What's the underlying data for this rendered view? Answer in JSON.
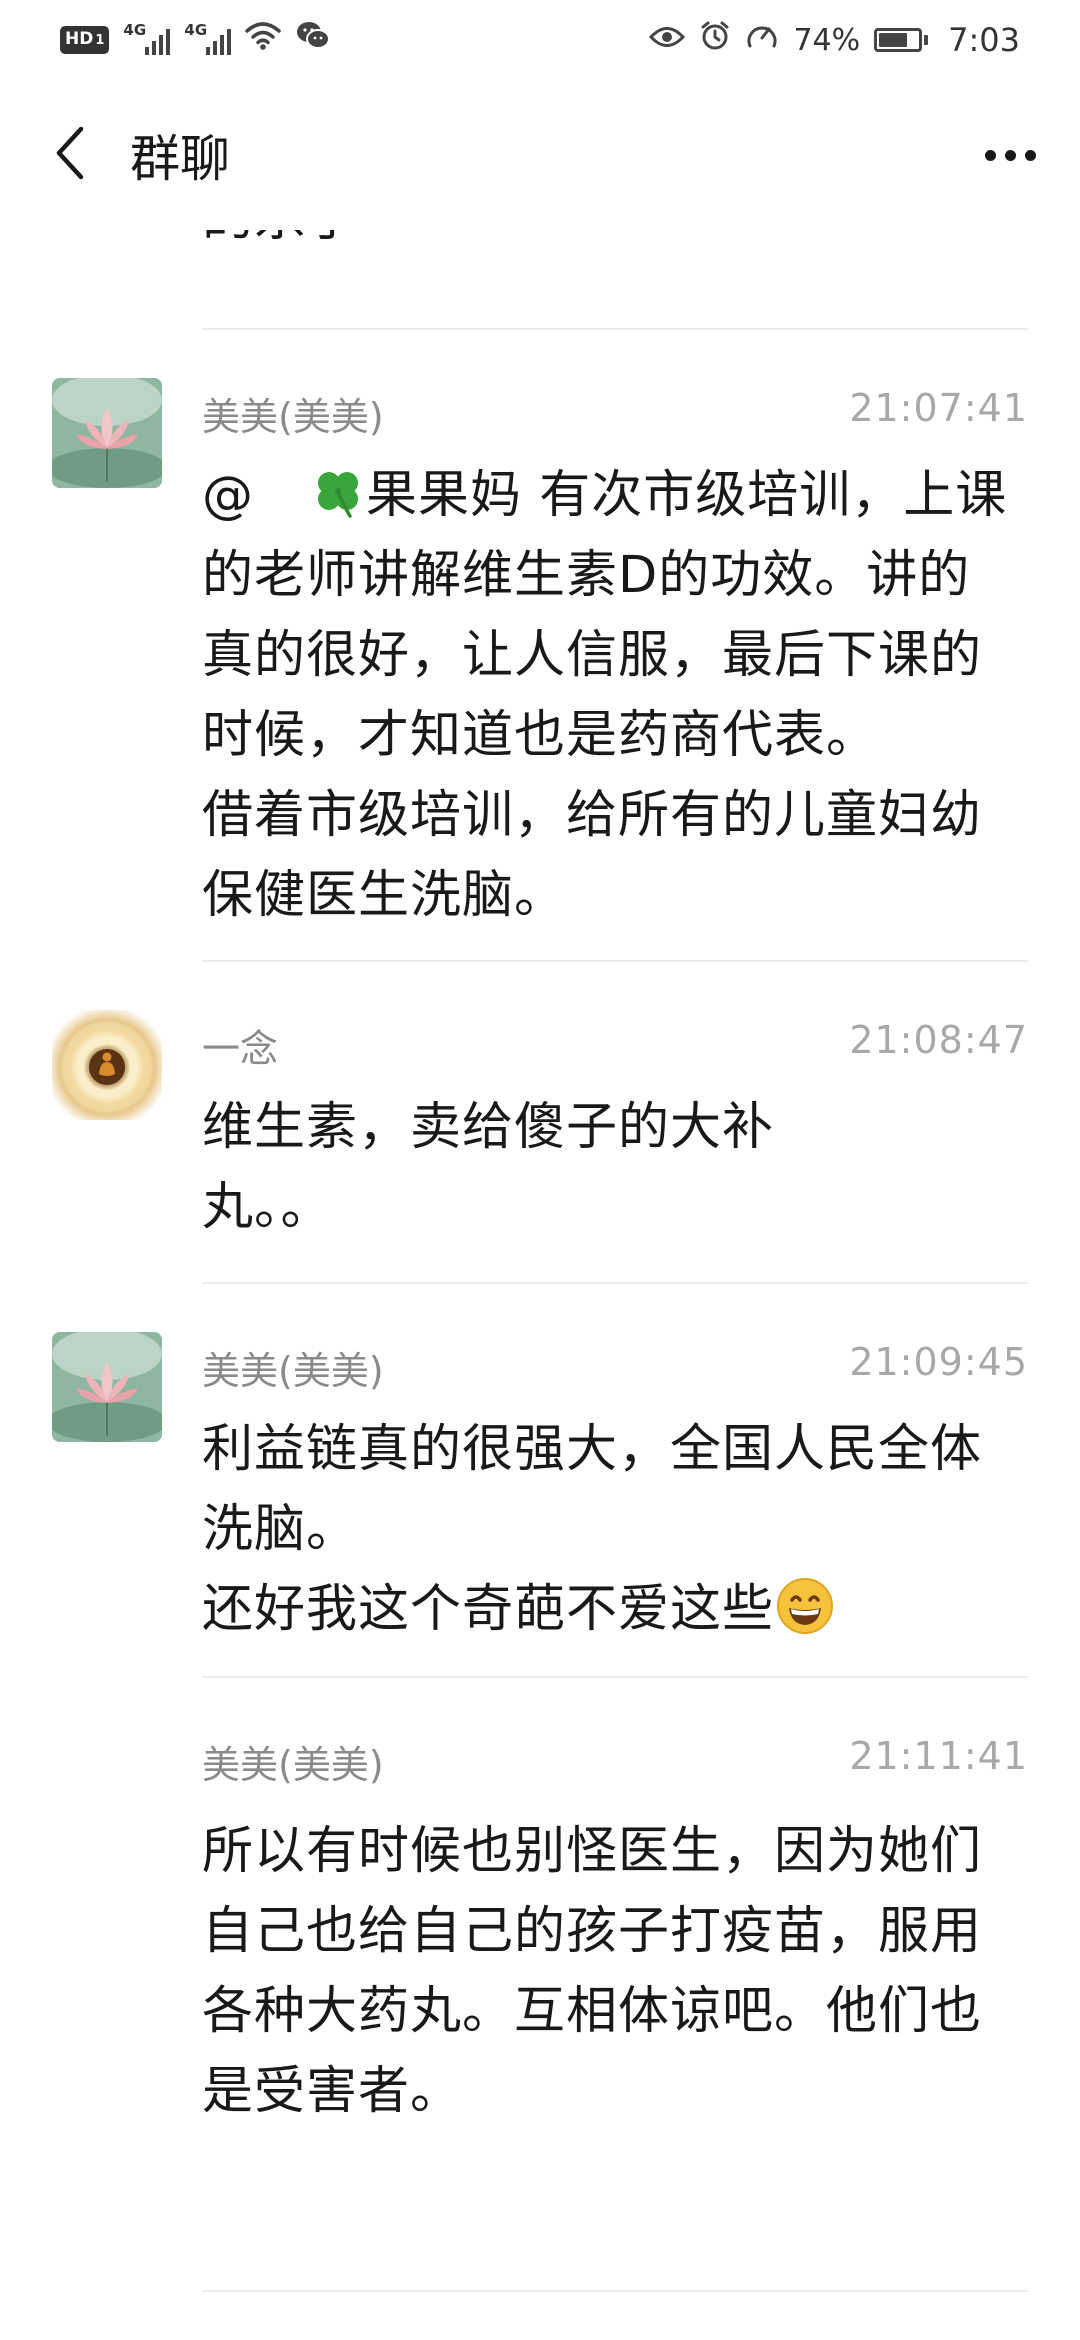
{
  "status_bar": {
    "hd": "HD",
    "hd_sub": "1",
    "network_1": "4G",
    "network_2": "4G",
    "battery_percent": "74%",
    "battery_level": 0.74,
    "time": "7:03",
    "icons": [
      "signal-icon",
      "wifi-icon",
      "wechat-icon",
      "eye-icon",
      "alarm-icon",
      "charging-icon",
      "battery-icon"
    ]
  },
  "header": {
    "title": "群聊",
    "back_icon": "chevron-left-icon",
    "more_icon": "more-dots-icon"
  },
  "clipped_top_text": "的杀手",
  "messages": [
    {
      "avatar": "lotus-avatar",
      "sender": "美美(美美)",
      "time": "21:07:41",
      "mention": "@",
      "clover_emoji": "🍀",
      "text_after_emoji": "果果妈 有次市级培训，上课的老师讲解维生素D的功效。讲的真的很好，让人信服，最后下课的时候，才知道也是药商代表。\n借着市级培训，给所有的儿童妇幼保健医生洗脑。"
    },
    {
      "avatar": "meditation-avatar",
      "sender": "一念",
      "time": "21:08:47",
      "text": "维生素，卖给傻子的大补\n丸。。"
    },
    {
      "avatar": "lotus-avatar",
      "sender": "美美(美美)",
      "time": "21:09:45",
      "text": "利益链真的很强大，全国人民全体洗脑。\n还好我这个奇葩不爱这些",
      "trailing_emoji": "😄"
    },
    {
      "avatar": "none",
      "sender": "美美(美美)",
      "time": "21:11:41",
      "text": "所以有时候也别怪医生，因为她们自己也给自己的孩子打疫苗，服用各种大药丸。互相体谅吧。他们也是受害者。"
    }
  ]
}
